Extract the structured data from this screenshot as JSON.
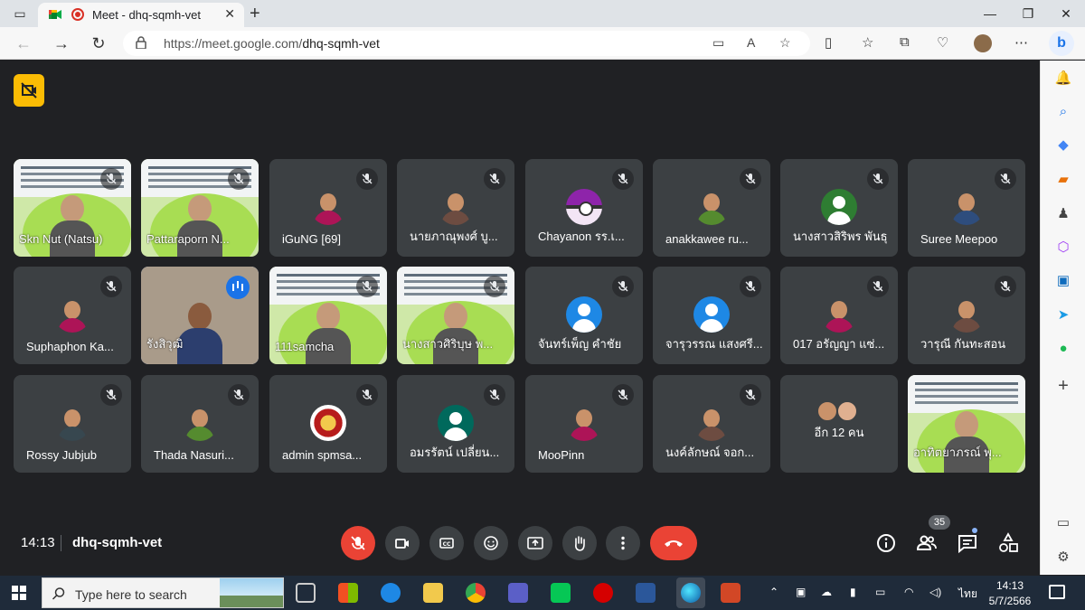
{
  "browser": {
    "tab_title": "Meet - dhq-sqmh-vet",
    "url_host": "https://meet.google.com/",
    "url_path": "dhq-sqmh-vet"
  },
  "meet": {
    "time": "14:13",
    "meeting_code": "dhq-sqmh-vet",
    "participant_count": "35",
    "participants": [
      {
        "name": "Skn Nut (Natsu)",
        "kind": "video",
        "muted": true
      },
      {
        "name": "Pattaraporn N...",
        "kind": "video",
        "muted": true
      },
      {
        "name": "iGuNG [69]",
        "kind": "photo",
        "muted": true
      },
      {
        "name": "นายภาณุพงศ์ บู...",
        "kind": "photo",
        "muted": true
      },
      {
        "name": "Chayanon รร.เ...",
        "kind": "pokeball",
        "muted": true
      },
      {
        "name": "anakkawee ru...",
        "kind": "photo",
        "muted": true
      },
      {
        "name": "นางสาวสิริพร พันธุ",
        "kind": "green",
        "muted": true
      },
      {
        "name": "Suree Meepoo",
        "kind": "photo",
        "muted": true
      },
      {
        "name": "Suphaphon Ka...",
        "kind": "photo",
        "muted": true
      },
      {
        "name": "รังสิวุฒิ",
        "kind": "office",
        "muted": false,
        "speaking": true
      },
      {
        "name": "111samcha",
        "kind": "video",
        "muted": true
      },
      {
        "name": "นางสาวศิริบุษ พ...",
        "kind": "video",
        "muted": true
      },
      {
        "name": "จันทร์เพ็ญ คำชัย",
        "kind": "blue",
        "muted": true
      },
      {
        "name": "จารุวรรณ แสงศรี...",
        "kind": "blue",
        "muted": true
      },
      {
        "name": "017 อรัญญา แซ่...",
        "kind": "photo",
        "muted": true
      },
      {
        "name": "วารุณี กันทะสอน",
        "kind": "photo",
        "muted": true
      },
      {
        "name": "Rossy Jubjub",
        "kind": "photo",
        "muted": true
      },
      {
        "name": "Thada Nasuri...",
        "kind": "photo",
        "muted": true
      },
      {
        "name": "admin spmsa...",
        "kind": "emblem",
        "muted": true
      },
      {
        "name": "อมรรัตน์ เปลี่ยน...",
        "kind": "teal",
        "muted": true
      },
      {
        "name": "MooPinn",
        "kind": "photo",
        "muted": true
      },
      {
        "name": "นงค์ลักษณ์ จอก...",
        "kind": "photo",
        "muted": true
      },
      {
        "name": "อีก 12 คน",
        "kind": "others",
        "muted": false
      },
      {
        "name": "อาทิตยาภรณ์ พุ...",
        "kind": "video",
        "muted": false
      }
    ]
  },
  "taskbar": {
    "search_placeholder": "Type here to search",
    "language": "ไทย",
    "time": "14:13",
    "date": "5/7/2566"
  }
}
